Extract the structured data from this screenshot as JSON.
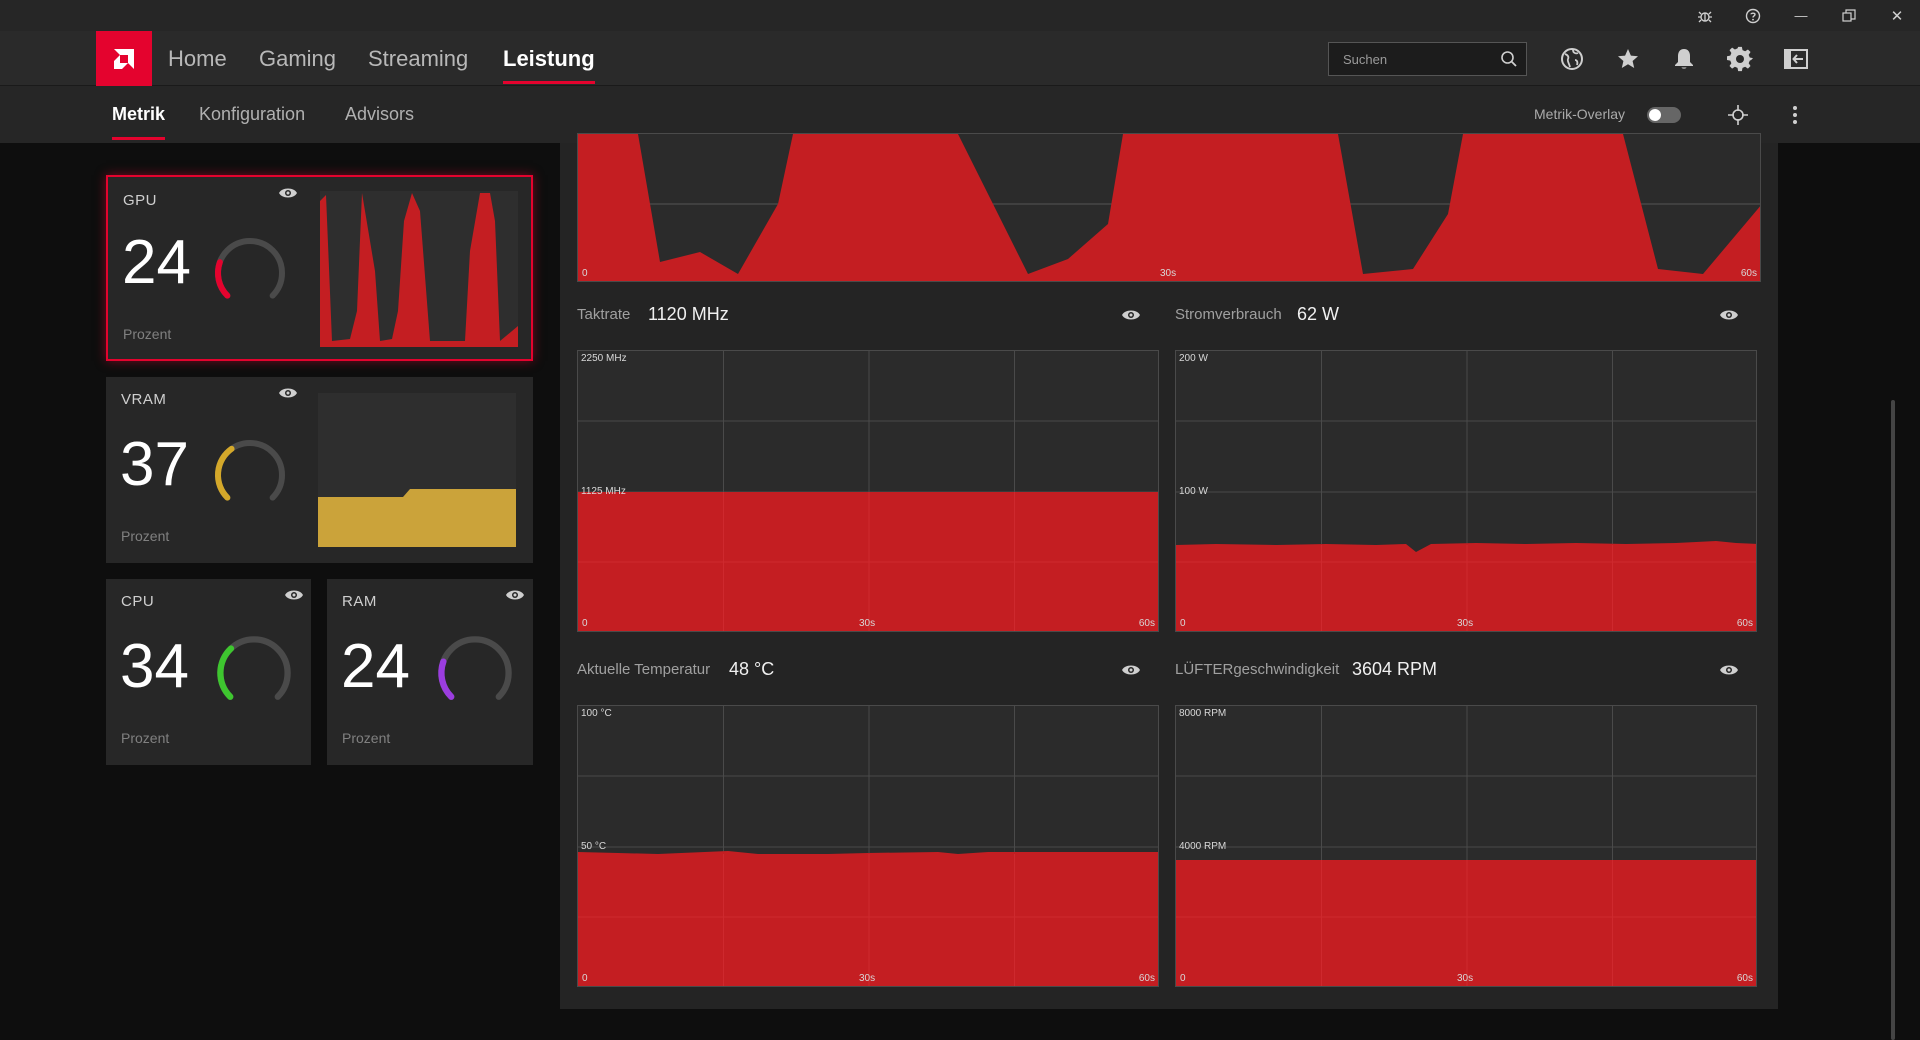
{
  "titlebar": {
    "icons": [
      "bug-icon",
      "help-icon",
      "minimize-icon",
      "restore-icon",
      "close-icon"
    ],
    "minimize": "—",
    "close": "✕"
  },
  "nav": {
    "tabs": [
      "Home",
      "Gaming",
      "Streaming",
      "Leistung"
    ],
    "active": "Leistung",
    "search_placeholder": "Suchen",
    "icons": [
      "globe-icon",
      "star-icon",
      "bell-icon",
      "gear-icon",
      "sidebar-icon"
    ]
  },
  "subnav": {
    "tabs": [
      "Metrik",
      "Konfiguration",
      "Advisors"
    ],
    "active": "Metrik",
    "overlay_label": "Metrik-Overlay",
    "overlay_on": false
  },
  "colors": {
    "accent": "#e4032e",
    "graph_fill": "#c41e22",
    "vram": "#d4a82a",
    "cpu": "#3ec62f",
    "ram": "#9b3ddf"
  },
  "cards": {
    "gpu": {
      "title": "GPU",
      "value": "24",
      "unit": "Prozent",
      "gauge_fraction": 0.24
    },
    "vram": {
      "title": "VRAM",
      "value": "37",
      "unit": "Prozent",
      "gauge_fraction": 0.37
    },
    "cpu": {
      "title": "CPU",
      "value": "34",
      "unit": "Prozent",
      "gauge_fraction": 0.34
    },
    "ram": {
      "title": "RAM",
      "value": "24",
      "unit": "Prozent",
      "gauge_fraction": 0.24
    }
  },
  "metrics": {
    "top": {
      "ylabel_min": "0",
      "x_mid": "30s",
      "x_end": "60s"
    },
    "clock": {
      "label": "Taktrate",
      "value": "1120 MHz",
      "y_max": "2250 MHz",
      "y_mid": "1125 MHz",
      "y_min": "0",
      "x_mid": "30s",
      "x_end": "60s"
    },
    "power": {
      "label": "Stromverbrauch",
      "value": "62 W",
      "y_max": "200 W",
      "y_mid": "100 W",
      "y_min": "0",
      "x_mid": "30s",
      "x_end": "60s"
    },
    "temp": {
      "label": "Aktuelle Temperatur",
      "value": "48 °C",
      "y_max": "100 °C",
      "y_mid": "50 °C",
      "y_min": "0",
      "x_mid": "30s",
      "x_end": "60s"
    },
    "fan": {
      "label": "LÜFTERgeschwindigkeit",
      "value": "3604 RPM",
      "y_max": "8000 RPM",
      "y_mid": "4000 RPM",
      "y_min": "0",
      "x_mid": "30s",
      "x_end": "60s"
    }
  }
}
